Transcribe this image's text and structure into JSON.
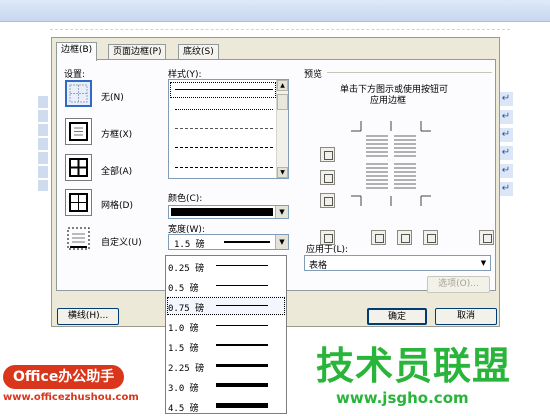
{
  "dialog": {
    "tabs": [
      "边框(B)",
      "页面边框(P)",
      "底纹(S)"
    ],
    "settings_label": "设置:",
    "settings": [
      {
        "label": "无(N)",
        "icon": "none-border-icon"
      },
      {
        "label": "方框(X)",
        "icon": "box-border-icon"
      },
      {
        "label": "全部(A)",
        "icon": "all-border-icon"
      },
      {
        "label": "网格(D)",
        "icon": "grid-border-icon"
      },
      {
        "label": "自定义(U)",
        "icon": "custom-border-icon"
      }
    ],
    "style_label": "样式(Y):",
    "color_label": "颜色(C):",
    "color_value": "#000000",
    "width_label": "宽度(W):",
    "width_value": "1.5 磅",
    "width_options": [
      "0.25 磅",
      "0.5 磅",
      "0.75 磅",
      "1.0 磅",
      "1.5 磅",
      "2.25 磅",
      "3.0 磅",
      "4.5 磅"
    ],
    "width_highlighted": "0.75 磅",
    "preview_label": "预览",
    "preview_hint_line1": "单击下方图示或使用按钮可",
    "preview_hint_line2": "应用边框",
    "apply_to_label": "应用于(L):",
    "apply_to_value": "表格",
    "options_button": "选项(O)...",
    "horizontal_line_button": "横线(H)...",
    "ok_button": "确定",
    "cancel_button": "取消"
  },
  "watermarks": {
    "left_brand": "Office办公助手",
    "left_url": "www.officezhushou.com",
    "right_brand": "技术员联盟",
    "right_url": "www.jsgho.com"
  },
  "colors": {
    "dialog_bg": "#ece9d8",
    "selection": "#316ac5",
    "left_brand": "#d9361c",
    "right_brand": "#29b43a"
  }
}
